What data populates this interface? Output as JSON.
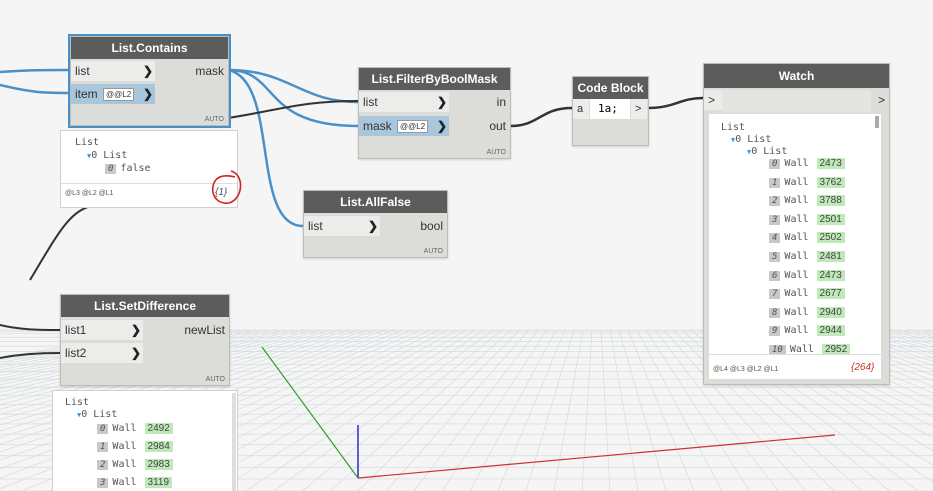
{
  "nodes": {
    "contains": {
      "title": "List.Contains",
      "in1": "list",
      "in2": "item",
      "out1": "mask",
      "level": "@@L2",
      "lacing": "AUTO"
    },
    "filter": {
      "title": "List.FilterByBoolMask",
      "in1": "list",
      "in2": "mask",
      "out1": "in",
      "out2": "out",
      "level": "@@L2",
      "lacing": "AUTO"
    },
    "codeblock": {
      "title": "Code Block",
      "code": "1a;",
      "in_a": "a",
      "out": ">"
    },
    "watch": {
      "title": "Watch",
      "in": ">",
      "out": ">",
      "count": "{264}",
      "levels": "@L4 @L3 @L2 @L1"
    },
    "allfalse": {
      "title": "List.AllFalse",
      "in1": "list",
      "out1": "bool",
      "lacing": "AUTO"
    },
    "setdiff": {
      "title": "List.SetDifference",
      "in1": "list1",
      "in2": "list2",
      "out1": "newList",
      "lacing": "AUTO"
    }
  },
  "contains_preview": {
    "l0": "List",
    "l1": "0 List",
    "idx": "0",
    "val": "false",
    "levels": "@L3 @L2 @L1",
    "count": "{1}"
  },
  "watch_tree": {
    "root": "List",
    "sub1": "0 List",
    "sub2": "0 List",
    "rows": [
      {
        "i": "0",
        "t": "Wall",
        "v": "2473"
      },
      {
        "i": "1",
        "t": "Wall",
        "v": "3762"
      },
      {
        "i": "2",
        "t": "Wall",
        "v": "3788"
      },
      {
        "i": "3",
        "t": "Wall",
        "v": "2501"
      },
      {
        "i": "4",
        "t": "Wall",
        "v": "2502"
      },
      {
        "i": "5",
        "t": "Wall",
        "v": "2481"
      },
      {
        "i": "6",
        "t": "Wall",
        "v": "2473"
      },
      {
        "i": "7",
        "t": "Wall",
        "v": "2677"
      },
      {
        "i": "8",
        "t": "Wall",
        "v": "2940"
      },
      {
        "i": "9",
        "t": "Wall",
        "v": "2944"
      },
      {
        "i": "10",
        "t": "Wall",
        "v": "2952"
      }
    ]
  },
  "setdiff_tree": {
    "root": "List",
    "sub1": "0 List",
    "rows": [
      {
        "i": "0",
        "t": "Wall",
        "v": "2492"
      },
      {
        "i": "1",
        "t": "Wall",
        "v": "2984"
      },
      {
        "i": "2",
        "t": "Wall",
        "v": "2983"
      },
      {
        "i": "3",
        "t": "Wall",
        "v": "3119"
      }
    ]
  },
  "colors": {
    "wire_blue": "#4a90c8",
    "wire_dark": "#333333",
    "node_header": "#5c5c5c",
    "value_green": "#bfe9b8"
  }
}
